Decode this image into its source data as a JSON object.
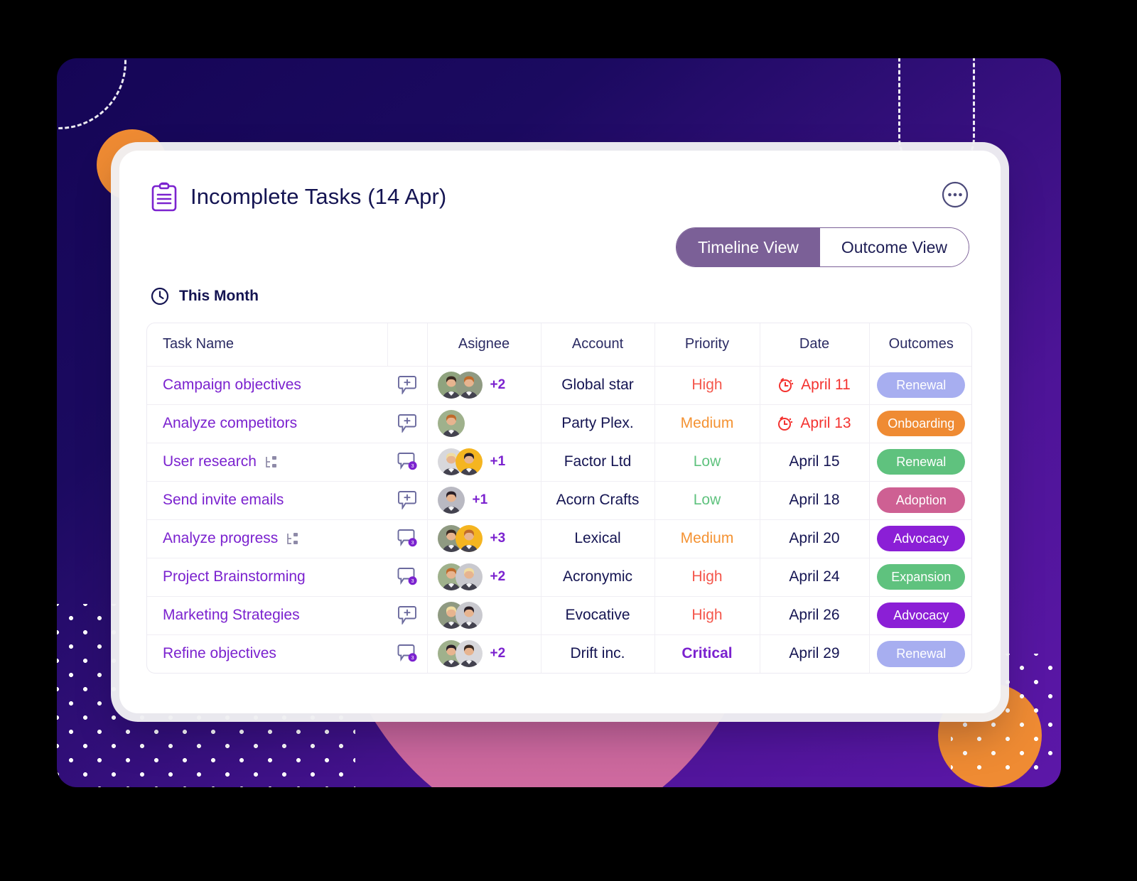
{
  "card": {
    "title": "Incomplete Tasks (14 Apr)",
    "title_icon": "clipboard-icon",
    "more_icon": "more-options-icon",
    "section": {
      "label": "This Month",
      "icon": "clock-icon"
    }
  },
  "toggle": {
    "active": "Timeline View",
    "inactive": "Outcome View",
    "active_bg": "#7b6097"
  },
  "table": {
    "columns": [
      "Task Name",
      "Asignee",
      "Account",
      "Priority",
      "Date",
      "Outcomes"
    ],
    "rows": [
      {
        "task": "Campaign objectives",
        "has_subtask": false,
        "comment": {
          "type": "add",
          "count": ""
        },
        "avatars": [
          "#8fa37e",
          "#8f9a82"
        ],
        "extra": "+2",
        "account": "Global star",
        "priority": "High",
        "priority_color": "#f4564b",
        "date": "April 11",
        "late": true,
        "outcome": "Renewal",
        "outcome_color": "#a7aef0"
      },
      {
        "task": "Analyze competitors",
        "has_subtask": false,
        "comment": {
          "type": "add",
          "count": ""
        },
        "avatars": [
          "#9fb18c"
        ],
        "extra": "",
        "account": "Party Plex.",
        "priority": "Medium",
        "priority_color": "#f49232",
        "date": "April 13",
        "late": true,
        "outcome": "Onboarding",
        "outcome_color": "#ef8b33"
      },
      {
        "task": "User research",
        "has_subtask": true,
        "comment": {
          "type": "count",
          "count": "3"
        },
        "avatars": [
          "#d8d8dc",
          "#f5b520"
        ],
        "extra": "+1",
        "account": "Factor Ltd",
        "priority": "Low",
        "priority_color": "#5fc27e",
        "date": "April 15",
        "late": false,
        "outcome": "Renewal",
        "outcome_color": "#5fc27e"
      },
      {
        "task": "Send invite emails",
        "has_subtask": false,
        "comment": {
          "type": "add",
          "count": ""
        },
        "avatars": [
          "#b9b9c2"
        ],
        "extra": "+1",
        "account": "Acorn Crafts",
        "priority": "Low",
        "priority_color": "#5fc27e",
        "date": "April 18",
        "late": false,
        "outcome": "Adoption",
        "outcome_color": "#ce6093"
      },
      {
        "task": "Analyze progress",
        "has_subtask": true,
        "comment": {
          "type": "count",
          "count": "3"
        },
        "avatars": [
          "#8f9a82",
          "#f5b520"
        ],
        "extra": "+3",
        "account": "Lexical",
        "priority": "Medium",
        "priority_color": "#f49232",
        "date": "April 20",
        "late": false,
        "outcome": "Advocacy",
        "outcome_color": "#8b1fd6"
      },
      {
        "task": "Project Brainstorming",
        "has_subtask": false,
        "comment": {
          "type": "count",
          "count": "3"
        },
        "avatars": [
          "#9fb18c",
          "#c9c9cf"
        ],
        "extra": "+2",
        "account": "Acronymic",
        "priority": "High",
        "priority_color": "#f4564b",
        "date": "April 24",
        "late": false,
        "outcome": "Expansion",
        "outcome_color": "#5fc27e"
      },
      {
        "task": "Marketing Strategies",
        "has_subtask": false,
        "comment": {
          "type": "add",
          "count": ""
        },
        "avatars": [
          "#8f9a82",
          "#c9c9cf"
        ],
        "extra": "",
        "account": "Evocative",
        "priority": "High",
        "priority_color": "#f4564b",
        "date": "April 26",
        "late": false,
        "outcome": "Advocacy",
        "outcome_color": "#8b1fd6"
      },
      {
        "task": "Refine objectives",
        "has_subtask": false,
        "comment": {
          "type": "count",
          "count": "3"
        },
        "avatars": [
          "#9fb18c",
          "#d8d8dc"
        ],
        "extra": "+2",
        "account": "Drift inc.",
        "priority": "Critical",
        "priority_color": "#7b22cf",
        "priority_bold": true,
        "date": "April 29",
        "late": false,
        "outcome": "Renewal",
        "outcome_color": "#a7aef0"
      }
    ]
  }
}
